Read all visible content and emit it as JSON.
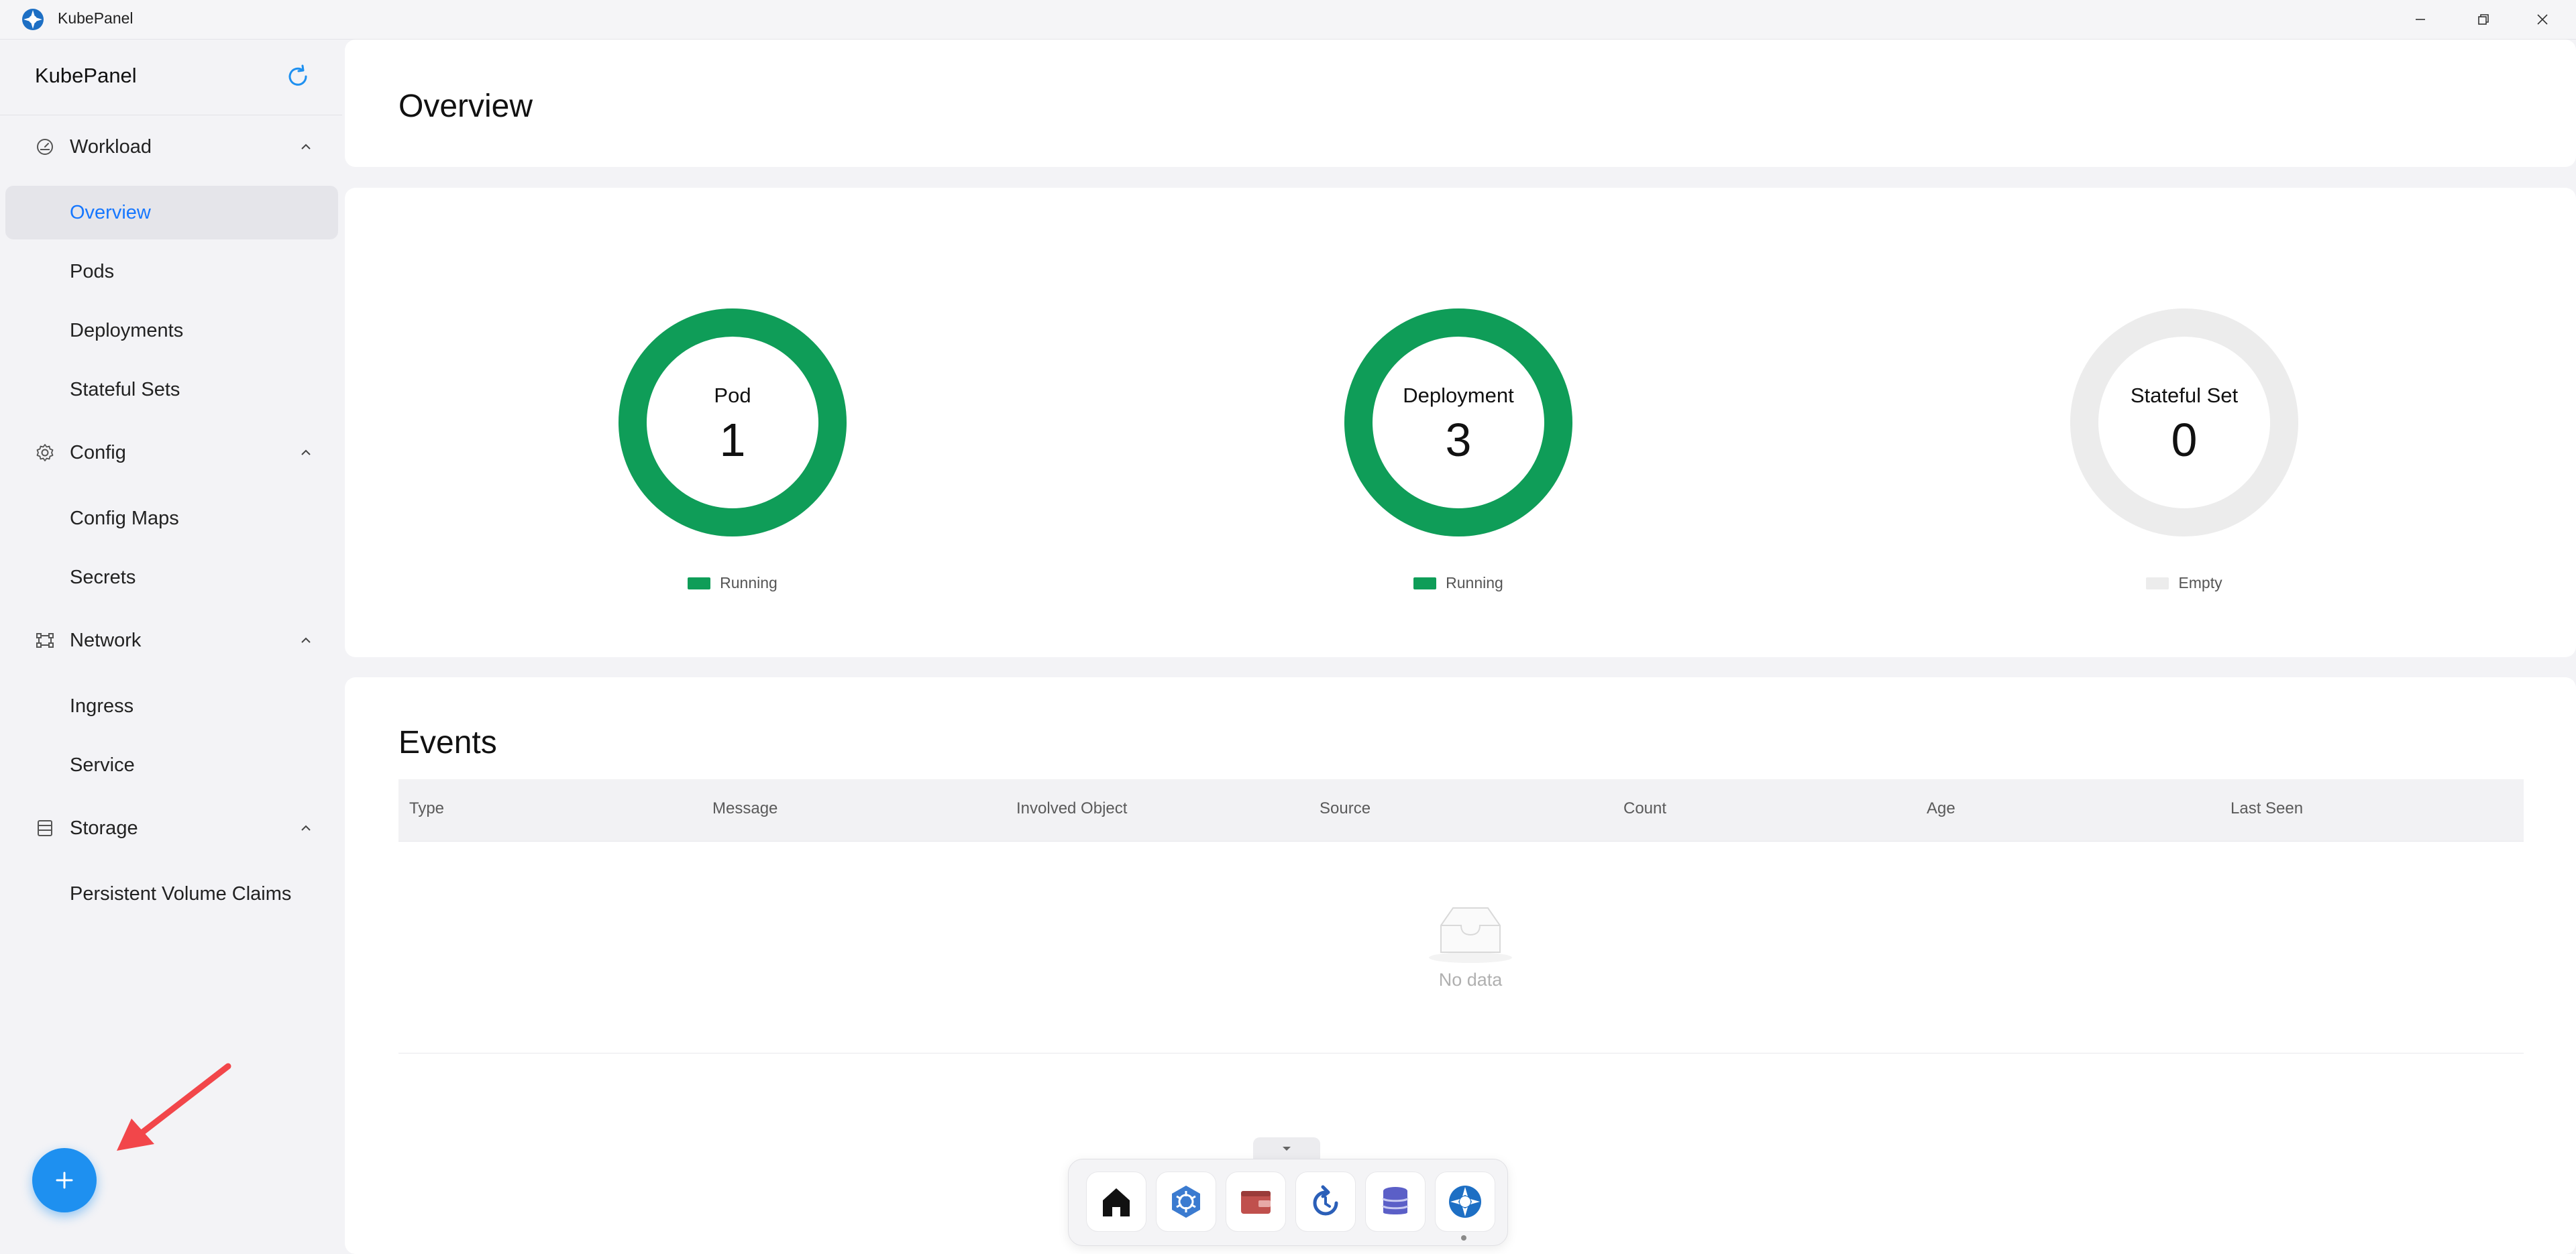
{
  "window": {
    "title": "KubePanel"
  },
  "sidebar": {
    "brand": "KubePanel",
    "groups": [
      {
        "label": "Workload",
        "icon": "dashboard-icon",
        "items": [
          {
            "label": "Overview",
            "active": true
          },
          {
            "label": "Pods"
          },
          {
            "label": "Deployments"
          },
          {
            "label": "Stateful Sets"
          }
        ]
      },
      {
        "label": "Config",
        "icon": "gear-icon",
        "items": [
          {
            "label": "Config Maps"
          },
          {
            "label": "Secrets"
          }
        ]
      },
      {
        "label": "Network",
        "icon": "network-icon",
        "items": [
          {
            "label": "Ingress"
          },
          {
            "label": "Service"
          }
        ]
      },
      {
        "label": "Storage",
        "icon": "storage-icon",
        "items": [
          {
            "label": "Persistent Volume Claims"
          }
        ]
      }
    ]
  },
  "overview": {
    "title": "Overview",
    "stats": [
      {
        "label": "Pod",
        "value": "1",
        "legend": "Running",
        "status_color": "#0f9d58",
        "filled_fraction": 1
      },
      {
        "label": "Deployment",
        "value": "3",
        "legend": "Running",
        "status_color": "#0f9d58",
        "filled_fraction": 1
      },
      {
        "label": "Stateful Set",
        "value": "0",
        "legend": "Empty",
        "status_color": "#ececec",
        "filled_fraction": 0
      }
    ]
  },
  "events": {
    "title": "Events",
    "columns": [
      "Type",
      "Message",
      "Involved Object",
      "Source",
      "Count",
      "Age",
      "Last Seen"
    ],
    "rows": [],
    "empty_text": "No data"
  },
  "dock": {
    "apps": [
      "home-icon",
      "kubernetes-helm-icon",
      "wallet-icon",
      "sync-icon",
      "database-icon",
      "kubepanel-icon"
    ]
  },
  "colors": {
    "accent": "#1677ff",
    "fab": "#1e90f0",
    "running": "#0f9d58",
    "annotation_arrow": "#f2464a"
  }
}
